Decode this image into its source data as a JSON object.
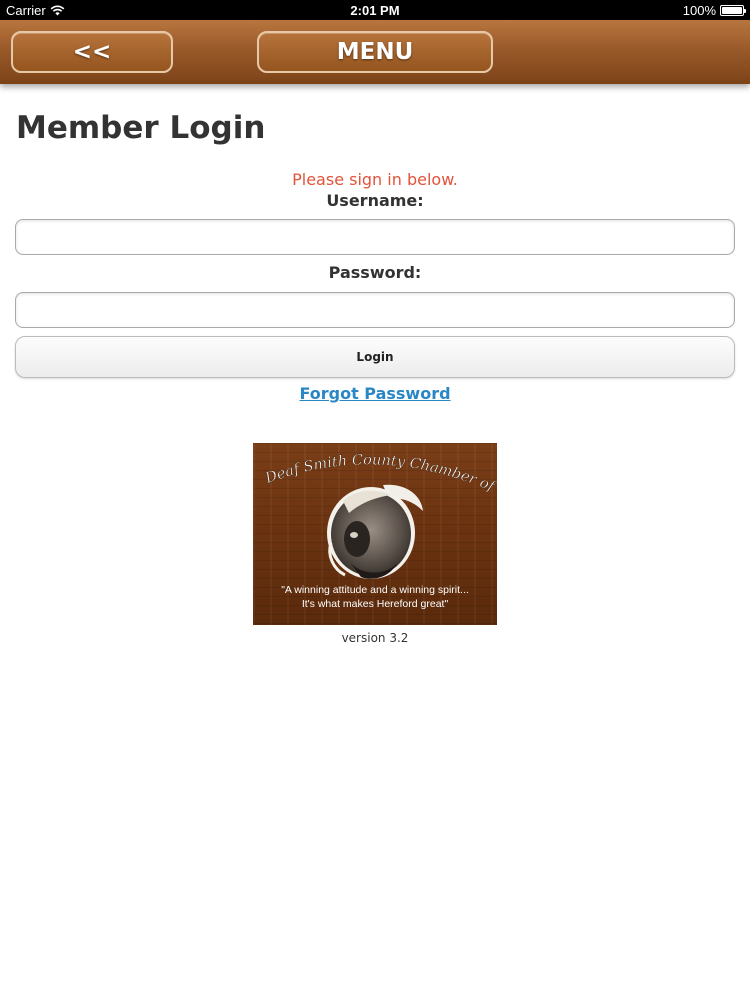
{
  "status_bar": {
    "carrier": "Carrier",
    "time": "2:01 PM",
    "battery": "100%",
    "battery_level": 1.0
  },
  "header": {
    "back_label": "<<",
    "menu_label": "MENU"
  },
  "login": {
    "title": "Member Login",
    "prompt": "Please sign in below.",
    "username_label": "Username:",
    "username_value": "",
    "password_label": "Password:",
    "password_value": "",
    "login_button": "Login",
    "forgot_link": "Forgot Password"
  },
  "logo": {
    "org_name": "Deaf Smith County Chamber of Commerce",
    "tagline_1": "\"A winning attitude and a winning spirit...",
    "tagline_2": "It's what makes Hereford great\""
  },
  "footer": {
    "version": "version 3.2"
  },
  "colors": {
    "header_brown": "#9a5a2a",
    "prompt_red": "#e2533a",
    "link_blue": "#2a87c6",
    "logo_wood": "#6a3210"
  },
  "icons": {
    "wifi": "wifi-icon",
    "battery": "battery-icon"
  }
}
